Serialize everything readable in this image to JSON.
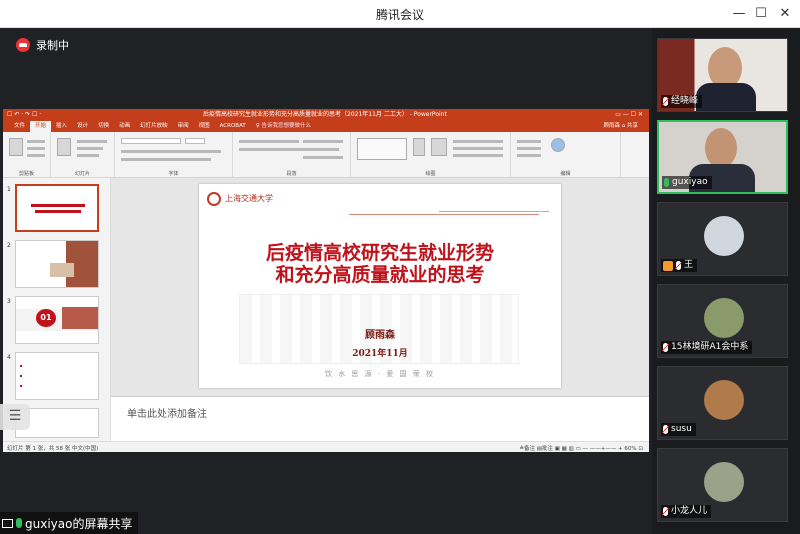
{
  "window": {
    "title": "腾讯会议",
    "min_glyph": "—",
    "max_glyph": "☐",
    "close_glyph": "✕"
  },
  "recording": {
    "label": "录制中"
  },
  "ppt": {
    "doc_title": "后疫情高校研究生就业形势和充分高质量就业的思考（2021年11月 二工大）  -  PowerPoint",
    "quick_access": "☐  ↶ · ↷  ☐ ·",
    "win_controls": "▭   —   ☐   ✕",
    "tabs": [
      "文件",
      "开始",
      "插入",
      "设计",
      "切换",
      "动画",
      "幻灯片放映",
      "审阅",
      "视图",
      "ACROBAT",
      "♀ 告诉我您想要做什么"
    ],
    "active_tab": 1,
    "account": "顾雨森   ⌂ 共享",
    "ribbon_groups": [
      "剪贴板",
      "幻灯片",
      "字体",
      "段落",
      "绘图",
      "编辑"
    ],
    "slide_numbers": [
      "1",
      "2",
      "3",
      "4",
      "5"
    ],
    "thumb3_label": "01",
    "slide": {
      "logo_text": "上海交通大学",
      "title_line1": "后疫情高校研究生就业形势",
      "title_line2": "和充分高质量就业的思考",
      "author": "顾雨森",
      "date": "2021年11月",
      "motto": "饮 水 思 源 · 爱 国 荣 校"
    },
    "notes_placeholder": "单击此处添加备注",
    "status_left": "幻灯片 第 1 张，共 58 张    中文(中国)",
    "status_right": "≙备注  ▤批注   ▣  ▦  ▥  ▭   —  ——+——  +   60%  ⊡"
  },
  "side_handle_glyph": "☰",
  "share": {
    "label": "guxiyao的屏幕共享"
  },
  "participants": [
    {
      "name": "经晓峰",
      "muted": true
    },
    {
      "name": "guxiyao",
      "muted": false,
      "active": true
    },
    {
      "name": "王",
      "muted": true
    },
    {
      "name": "15林境研A1会中系",
      "muted": true
    },
    {
      "name": "susu",
      "muted": true
    },
    {
      "name": "小龙人儿",
      "muted": true
    }
  ]
}
